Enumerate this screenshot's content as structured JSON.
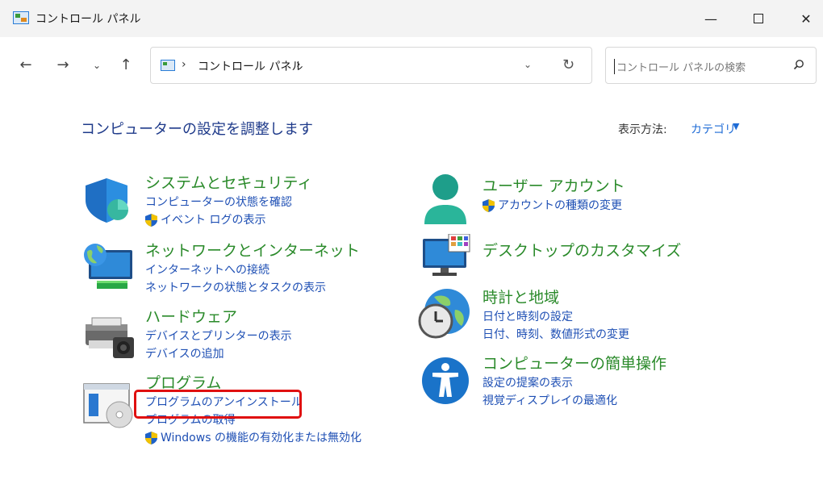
{
  "window": {
    "title": "コントロール パネル",
    "minimize": "—",
    "close": "✕"
  },
  "nav": {
    "back": "←",
    "forward": "→",
    "recent": "⌄",
    "up": "↑",
    "separator": "›",
    "address": "コントロール パネル",
    "dropdown": "⌄",
    "refresh": "↻",
    "search_placeholder": "コントロール パネルの検索"
  },
  "header": {
    "title": "コンピューターの設定を調整します",
    "view_label": "表示方法:",
    "view_value": "カテゴリ",
    "view_caret": "▼"
  },
  "categories": [
    {
      "icon": "security-shield-icon",
      "title": "システムとセキュリティ",
      "links": [
        {
          "label": "コンピューターの状態を確認",
          "shield": false
        },
        {
          "label": "イベント ログの表示",
          "shield": true
        }
      ]
    },
    {
      "icon": "network-globe-icon",
      "title": "ネットワークとインターネット",
      "links": [
        {
          "label": "インターネットへの接続",
          "shield": false
        },
        {
          "label": "ネットワークの状態とタスクの表示",
          "shield": false
        }
      ]
    },
    {
      "icon": "printer-hardware-icon",
      "title": "ハードウェア",
      "links": [
        {
          "label": "デバイスとプリンターの表示",
          "shield": false
        },
        {
          "label": "デバイスの追加",
          "shield": false
        }
      ]
    },
    {
      "icon": "programs-disc-icon",
      "title": "プログラム",
      "links": [
        {
          "label": "プログラムのアンインストール",
          "shield": false
        },
        {
          "label": "プログラムの取得",
          "shield": false
        },
        {
          "label": "Windows の機能の有効化または無効化",
          "shield": true
        }
      ]
    },
    {
      "icon": "user-account-icon",
      "title": "ユーザー アカウント",
      "links": [
        {
          "label": "アカウントの種類の変更",
          "shield": true
        }
      ]
    },
    {
      "icon": "desktop-monitor-icon",
      "title": "デスクトップのカスタマイズ",
      "links": []
    },
    {
      "icon": "clock-globe-icon",
      "title": "時計と地域",
      "links": [
        {
          "label": "日付と時刻の設定",
          "shield": false
        },
        {
          "label": "日付、時刻、数値形式の変更",
          "shield": false
        }
      ]
    },
    {
      "icon": "accessibility-icon",
      "title": "コンピューターの簡単操作",
      "links": [
        {
          "label": "設定の提案の表示",
          "shield": false
        },
        {
          "label": "視覚ディスプレイの最適化",
          "shield": false
        }
      ]
    }
  ],
  "colors": {
    "category_title": "#2a8a2a",
    "link": "#1e4fb4",
    "highlight": "#e01010"
  }
}
